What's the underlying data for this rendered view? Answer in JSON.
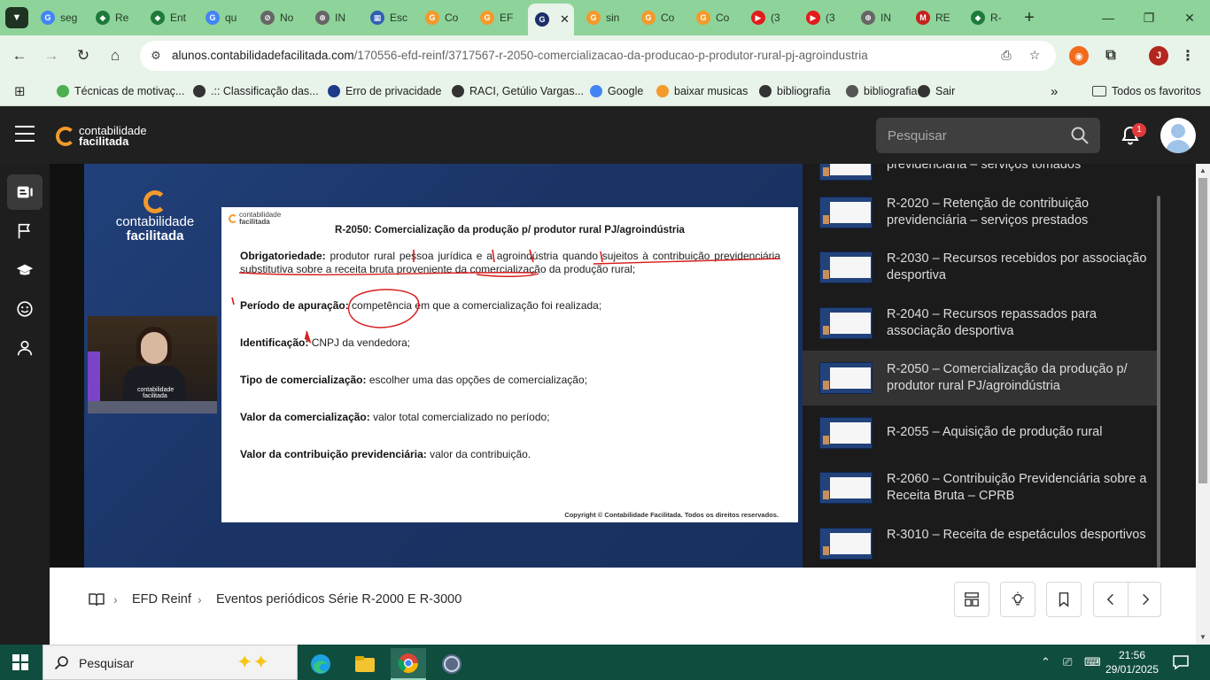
{
  "browser": {
    "tabs": [
      {
        "label": "seg",
        "color": "#4285f4",
        "glyph": "G"
      },
      {
        "label": "Re",
        "color": "#1e7a3a",
        "glyph": "◆"
      },
      {
        "label": "Ent",
        "color": "#1e7a3a",
        "glyph": "◆"
      },
      {
        "label": "qu",
        "color": "#4285f4",
        "glyph": "G"
      },
      {
        "label": "No",
        "color": "#666666",
        "glyph": "⊘"
      },
      {
        "label": "IN",
        "color": "#666666",
        "glyph": "⊕"
      },
      {
        "label": "Esc",
        "color": "#2f5fb3",
        "glyph": "▦"
      },
      {
        "label": "Co",
        "color": "#f39a2b",
        "glyph": "G"
      },
      {
        "label": "EF",
        "color": "#f39a2b",
        "glyph": "G"
      },
      {
        "label": "",
        "color": "#1c2f6b",
        "glyph": "G",
        "active": true
      },
      {
        "label": "sin",
        "color": "#f39a2b",
        "glyph": "G"
      },
      {
        "label": "Co",
        "color": "#f39a2b",
        "glyph": "G"
      },
      {
        "label": "Co",
        "color": "#f39a2b",
        "glyph": "G"
      },
      {
        "label": "(3",
        "color": "#e21c1c",
        "glyph": "▶"
      },
      {
        "label": "(3",
        "color": "#e21c1c",
        "glyph": "▶"
      },
      {
        "label": "IN",
        "color": "#666666",
        "glyph": "⊕"
      },
      {
        "label": "RE",
        "color": "#c5221f",
        "glyph": "M"
      },
      {
        "label": "R-",
        "color": "#1e7a3a",
        "glyph": "◆"
      }
    ],
    "url_host": "alunos.contabilidadefacilitada.com",
    "url_path": "/170556-efd-reinf/3717567-r-2050-comercializacao-da-producao-p-produtor-rural-pj-agroindustria",
    "profile_initial": "J",
    "bookmarks": [
      {
        "label": "Técnicas de motivaç...",
        "color": "#4caf50"
      },
      {
        "label": ".:: Classificação das...",
        "color": "#333333"
      },
      {
        "label": "Erro de privacidade",
        "color": "#1e3b8a"
      },
      {
        "label": "RACI, Getúlio Vargas...",
        "color": "#333333"
      },
      {
        "label": "Google",
        "color": "#4285f4"
      },
      {
        "label": "baixar musicas",
        "color": "#f39a2b"
      },
      {
        "label": "bibliografia",
        "color": "#333333"
      },
      {
        "label": "bibliografia",
        "color": "#555555"
      },
      {
        "label": "Sair",
        "color": "#333333"
      }
    ],
    "bookmarks_more": "»",
    "all_bookmarks": "Todos os favoritos"
  },
  "site": {
    "logo_line1": "contabilidade",
    "logo_line2": "facilitada",
    "search_placeholder": "Pesquisar",
    "notif_count": "1"
  },
  "slide": {
    "logo_line1": "contabilidade",
    "logo_line2": "facilitada",
    "title": "R-2050: Comercialização da produção p/ produtor rural PJ/agroindústria",
    "rows": [
      {
        "label": "Obrigatoriedade:",
        "text": "produtor rural pessoa jurídica e a agroindústria quando sujeitos à contribuição previdenciária substitutiva sobre a receita bruta proveniente da comercialização da produção rural;"
      },
      {
        "label": "Período de apuração:",
        "text": "competência em que a comercialização foi realizada;"
      },
      {
        "label": "Identificação:",
        "text": "CNPJ da vendedora;"
      },
      {
        "label": "Tipo de comercialização:",
        "text": "escolher uma das opções de comercialização;"
      },
      {
        "label": "Valor da comercialização:",
        "text": "valor total comercializado no período;"
      },
      {
        "label": "Valor da contribuição previdenciária:",
        "text": "valor da contribuição."
      }
    ],
    "copyright": "Copyright © Contabilidade Facilitada. Todos os direitos reservados.",
    "video_logo_line1": "contabilidade",
    "video_logo_line2": "facilitada",
    "shirt_text": "contabilidade facilitada"
  },
  "playlist": {
    "items": [
      {
        "text": "previdenciária – serviços tomados"
      },
      {
        "text": "R-2020 – Retenção de contribuição previdenciária – serviços prestados"
      },
      {
        "text": "R-2030 – Recursos recebidos por associação desportiva"
      },
      {
        "text": "R-2040 – Recursos repassados para associação desportiva"
      },
      {
        "text": "R-2050 – Comercialização da produção p/ produtor rural PJ/agroindústria",
        "active": true
      },
      {
        "text": "R-2055 – Aquisição de produção rural"
      },
      {
        "text": "R-2060 – Contribuição Previdenciária sobre a Receita Bruta – CPRB"
      },
      {
        "text": "R-3010 – Receita de espetáculos desportivos"
      }
    ]
  },
  "breadcrumb": {
    "course": "EFD Reinf",
    "module": "Eventos periódicos Série R-2000 E R-3000"
  },
  "taskbar": {
    "search_label": "Pesquisar",
    "time": "21:56",
    "date": "29/01/2025"
  }
}
